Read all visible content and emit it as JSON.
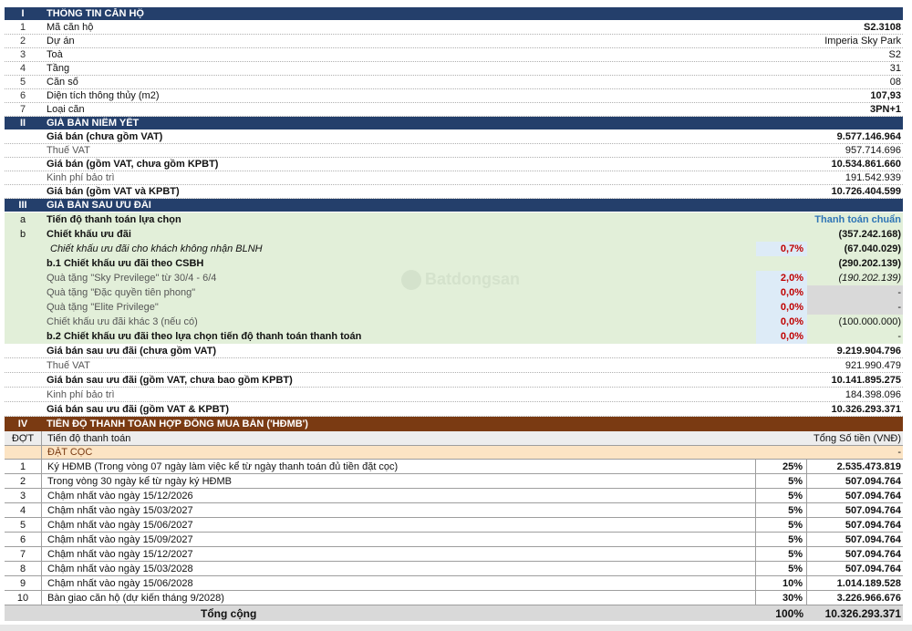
{
  "section1": {
    "num": "I",
    "title": "THÔNG TIN CĂN HỘ",
    "rows": [
      {
        "n": "1",
        "label": "Mã căn hộ",
        "value": "S2.3108",
        "bold": true
      },
      {
        "n": "2",
        "label": "Dự án",
        "value": "Imperia Sky Park",
        "bold": false
      },
      {
        "n": "3",
        "label": "Toà",
        "value": "S2",
        "bold": false
      },
      {
        "n": "4",
        "label": "Tầng",
        "value": "31",
        "bold": false
      },
      {
        "n": "5",
        "label": "Căn số",
        "value": "08",
        "bold": false
      },
      {
        "n": "6",
        "label": "Diện tích thông thủy (m2)",
        "value": "107,93",
        "bold": true
      },
      {
        "n": "7",
        "label": "Loại căn",
        "value": "3PN+1",
        "bold": true
      }
    ]
  },
  "section2": {
    "num": "II",
    "title": "GIÁ BÁN NIÊM YẾT",
    "rows": [
      {
        "label": "Giá bán (chưa gồm VAT)",
        "value": "9.577.146.964",
        "bold": true
      },
      {
        "label": "Thuế VAT",
        "value": "957.714.696",
        "bold": false
      },
      {
        "label": "Giá bán (gồm VAT, chưa gồm KPBT)",
        "value": "10.534.861.660",
        "bold": true
      },
      {
        "label": "Kinh phí bảo trì",
        "value": "191.542.939",
        "bold": false
      },
      {
        "label": "Giá bán (gồm VAT và KPBT)",
        "value": "10.726.404.599",
        "bold": true
      }
    ]
  },
  "section3": {
    "num": "III",
    "title": "GIÁ BÁN SAU ƯU ĐÃI",
    "row_a": {
      "n": "a",
      "label": "Tiến độ thanh toán lựa chọn",
      "value": "Thanh toán chuẩn"
    },
    "row_b": {
      "n": "b",
      "label": "Chiết khấu ưu đãi",
      "value": "(357.242.168)"
    },
    "row_blnh": {
      "label": "Chiết khấu ưu đãi cho khách không nhận BLNH",
      "pct": "0,7%",
      "value": "(67.040.029)"
    },
    "row_b1": {
      "label": "b.1 Chiết khấu ưu đãi theo CSBH",
      "value": "(290.202.139)"
    },
    "gifts": [
      {
        "label": "Quà tặng \"Sky Previlege\" từ 30/4 - 6/4",
        "pct": "2,0%",
        "value": "(190.202.139)",
        "italic": true
      },
      {
        "label": "Quà tặng \"Đặc quyền tiên phong\"",
        "pct": "0,0%",
        "value": "-",
        "italic": false
      },
      {
        "label": "Quà tặng \"Elite Privilege\"",
        "pct": "0,0%",
        "value": "-",
        "italic": false
      }
    ],
    "row_other": {
      "label": "Chiết khấu ưu đãi khác 3 (nếu có)",
      "pct": "0,0%",
      "value": "(100.000.000)"
    },
    "row_b2": {
      "label": "b.2 Chiết khấu ưu đãi theo lựa chọn tiến độ thanh toán thanh toán",
      "pct": "0,0%",
      "value": "-"
    },
    "prices": [
      {
        "label": "Giá bán sau ưu đãi (chưa gồm VAT)",
        "value": "9.219.904.796",
        "bold": true
      },
      {
        "label": "Thuế VAT",
        "value": "921.990.479",
        "bold": false
      },
      {
        "label": "Giá bán sau ưu đãi (gồm VAT, chưa bao gồm KPBT)",
        "value": "10.141.895.275",
        "bold": true
      },
      {
        "label": "Kinh phí bảo trì",
        "value": "184.398.096",
        "bold": false
      },
      {
        "label": "Giá bán sau ưu đãi (gồm VAT & KPBT)",
        "value": "10.326.293.371",
        "bold": true
      }
    ]
  },
  "section4": {
    "num": "IV",
    "title": "TIẾN ĐỘ THANH TOÁN HỢP ĐỒNG MUA BÁN ('HĐMB')",
    "col_stage": "ĐỢT",
    "col_progress": "Tiến độ thanh toán",
    "col_total": "Tổng Số tiền (VNĐ)",
    "deposit_label": "ĐẶT CỌC",
    "deposit_value": "-",
    "payments": [
      {
        "n": "1",
        "label": "Ký HĐMB (Trong vòng 07 ngày làm việc kể từ ngày thanh toán đủ tiền đặt cọc)",
        "pct": "25%",
        "value": "2.535.473.819"
      },
      {
        "n": "2",
        "label": "Trong vòng 30 ngày kể từ ngày ký HĐMB",
        "pct": "5%",
        "value": "507.094.764"
      },
      {
        "n": "3",
        "label": "Chậm nhất vào ngày 15/12/2026",
        "pct": "5%",
        "value": "507.094.764"
      },
      {
        "n": "4",
        "label": "Chậm nhất vào ngày 15/03/2027",
        "pct": "5%",
        "value": "507.094.764"
      },
      {
        "n": "5",
        "label": "Chậm nhất vào ngày 15/06/2027",
        "pct": "5%",
        "value": "507.094.764"
      },
      {
        "n": "6",
        "label": "Chậm nhất vào ngày 15/09/2027",
        "pct": "5%",
        "value": "507.094.764"
      },
      {
        "n": "7",
        "label": "Chậm nhất vào ngày 15/12/2027",
        "pct": "5%",
        "value": "507.094.764"
      },
      {
        "n": "8",
        "label": "Chậm nhất vào ngày 15/03/2028",
        "pct": "5%",
        "value": "507.094.764"
      },
      {
        "n": "9",
        "label": "Chậm nhất vào ngày 15/06/2028",
        "pct": "10%",
        "value": "1.014.189.528"
      },
      {
        "n": "10",
        "label": "Bàn giao căn hộ (dự kiến tháng 9/2028)",
        "pct": "30%",
        "value": "3.226.966.676"
      }
    ],
    "total_label": "Tổng cộng",
    "total_pct": "100%",
    "total_value": "10.326.293.371"
  },
  "watermark": "Batdongsan"
}
